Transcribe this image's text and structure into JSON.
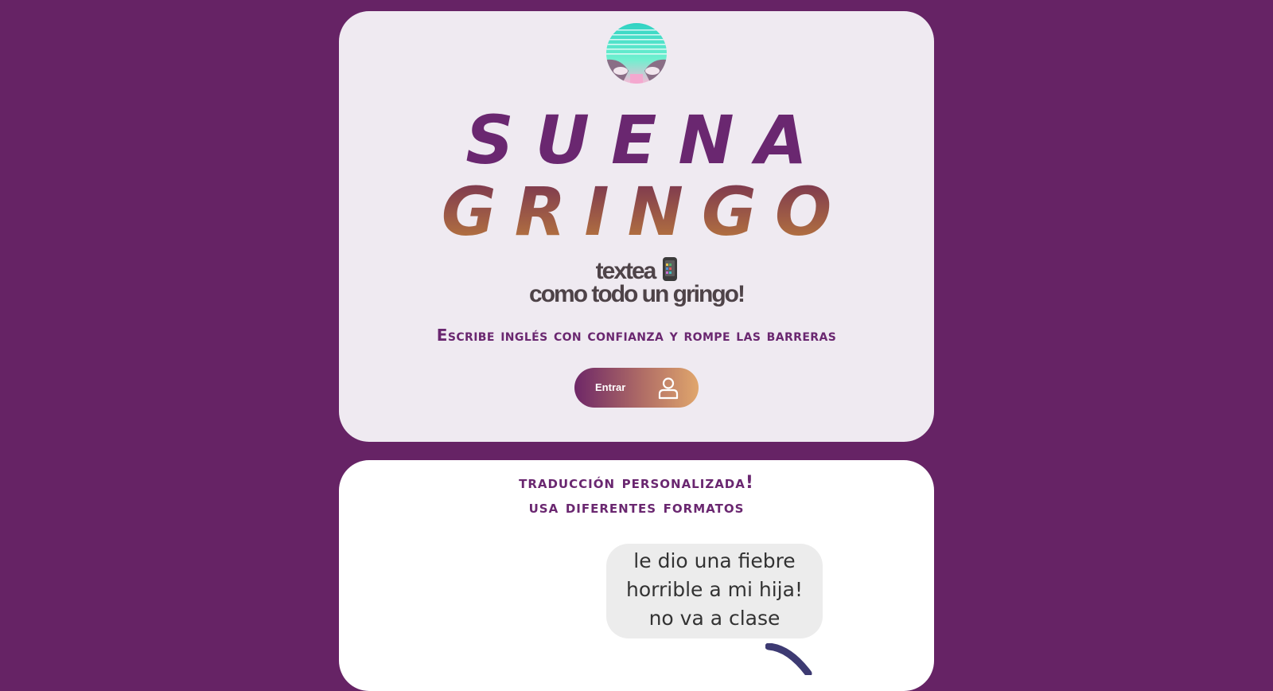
{
  "hero": {
    "title_line1": "SUENA",
    "title_line2": "GRINGO",
    "tagline_line1": "textea",
    "tagline_line2": "como todo un gringo!",
    "subtitle": "Escribe inglés con confianza y rompe las barreras",
    "enter_button": "Entrar"
  },
  "feature": {
    "heading_line1": "traducción personalizada!",
    "heading_line2": "usa diferentes formatos",
    "chat_bubble": {
      "line1": "le dio una fiebre",
      "line2": "horrible a mi hija!",
      "line3": "no va a clase"
    }
  },
  "colors": {
    "page_background": "#662365",
    "hero_card": "#efeaf1",
    "brand_purple": "#6a2770",
    "brand_gold": "#b8773e"
  },
  "icons": {
    "logo": "sunset-logo",
    "tagline_icon": "mobile-phone-icon",
    "enter_icon": "user-icon"
  }
}
